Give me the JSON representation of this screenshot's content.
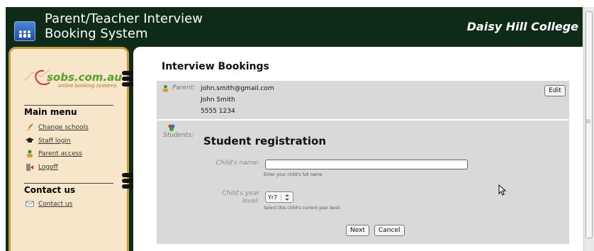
{
  "header": {
    "title_line1": "Parent/Teacher Interview",
    "title_line2": "Booking System",
    "college": "Daisy Hill College",
    "logo_icon": "people-icon"
  },
  "sidebar": {
    "logo_text": "sobs.com.au",
    "logo_subtext": "online booking systems",
    "main_menu_title": "Main menu",
    "menu_items": [
      {
        "label": "Change schools",
        "icon": "broom-icon"
      },
      {
        "label": "Staff login",
        "icon": "graduation-cap-icon"
      },
      {
        "label": "Parent access",
        "icon": "parent-icon"
      },
      {
        "label": "Logoff",
        "icon": "logoff-icon"
      }
    ],
    "contact_title": "Contact us",
    "contact_items": [
      {
        "label": "Contact us",
        "icon": "envelope-icon"
      }
    ]
  },
  "main": {
    "heading": "Interview Bookings",
    "parent": {
      "label": "Parent:",
      "email": "john.smith@gmail.com",
      "name": "John Smith",
      "phone": "5555 1234",
      "edit_label": "Edit"
    },
    "students": {
      "label": "Students:",
      "registration_title": "Student registration",
      "child_name_label": "Child's name:",
      "child_name_value": "",
      "child_name_hint": "Enter your child's full name",
      "child_year_label_1": "Child's year",
      "child_year_label_2": "level:",
      "child_year_value": "Yr7",
      "child_year_hint": "Select this child's current year level",
      "next_label": "Next",
      "cancel_label": "Cancel"
    }
  },
  "colors": {
    "header_bg": "#0e2b17",
    "sidebar_bg": "#f7e6c9",
    "sidebar_border": "#c79a3e",
    "panel_bg": "#d9d9d9",
    "logo_green": "#58a02c"
  }
}
